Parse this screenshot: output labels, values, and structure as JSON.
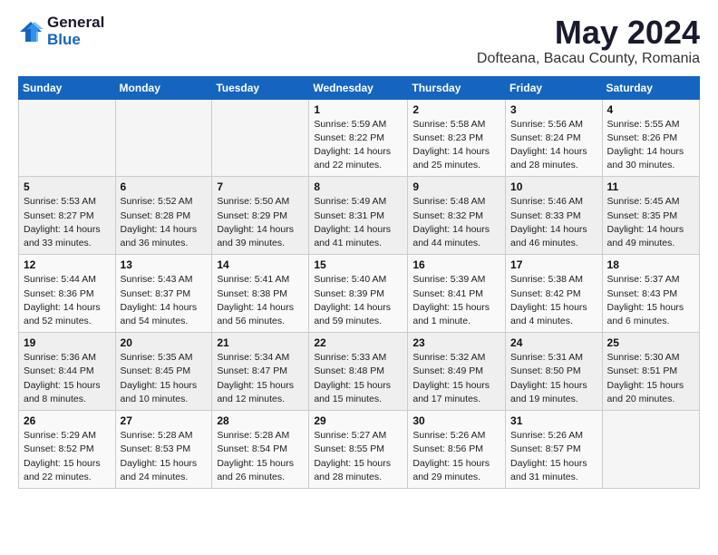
{
  "header": {
    "logo_general": "General",
    "logo_blue": "Blue",
    "title": "May 2024",
    "subtitle": "Dofteana, Bacau County, Romania"
  },
  "days_of_week": [
    "Sunday",
    "Monday",
    "Tuesday",
    "Wednesday",
    "Thursday",
    "Friday",
    "Saturday"
  ],
  "weeks": [
    [
      {
        "num": "",
        "info": ""
      },
      {
        "num": "",
        "info": ""
      },
      {
        "num": "",
        "info": ""
      },
      {
        "num": "1",
        "info": "Sunrise: 5:59 AM\nSunset: 8:22 PM\nDaylight: 14 hours\nand 22 minutes."
      },
      {
        "num": "2",
        "info": "Sunrise: 5:58 AM\nSunset: 8:23 PM\nDaylight: 14 hours\nand 25 minutes."
      },
      {
        "num": "3",
        "info": "Sunrise: 5:56 AM\nSunset: 8:24 PM\nDaylight: 14 hours\nand 28 minutes."
      },
      {
        "num": "4",
        "info": "Sunrise: 5:55 AM\nSunset: 8:26 PM\nDaylight: 14 hours\nand 30 minutes."
      }
    ],
    [
      {
        "num": "5",
        "info": "Sunrise: 5:53 AM\nSunset: 8:27 PM\nDaylight: 14 hours\nand 33 minutes."
      },
      {
        "num": "6",
        "info": "Sunrise: 5:52 AM\nSunset: 8:28 PM\nDaylight: 14 hours\nand 36 minutes."
      },
      {
        "num": "7",
        "info": "Sunrise: 5:50 AM\nSunset: 8:29 PM\nDaylight: 14 hours\nand 39 minutes."
      },
      {
        "num": "8",
        "info": "Sunrise: 5:49 AM\nSunset: 8:31 PM\nDaylight: 14 hours\nand 41 minutes."
      },
      {
        "num": "9",
        "info": "Sunrise: 5:48 AM\nSunset: 8:32 PM\nDaylight: 14 hours\nand 44 minutes."
      },
      {
        "num": "10",
        "info": "Sunrise: 5:46 AM\nSunset: 8:33 PM\nDaylight: 14 hours\nand 46 minutes."
      },
      {
        "num": "11",
        "info": "Sunrise: 5:45 AM\nSunset: 8:35 PM\nDaylight: 14 hours\nand 49 minutes."
      }
    ],
    [
      {
        "num": "12",
        "info": "Sunrise: 5:44 AM\nSunset: 8:36 PM\nDaylight: 14 hours\nand 52 minutes."
      },
      {
        "num": "13",
        "info": "Sunrise: 5:43 AM\nSunset: 8:37 PM\nDaylight: 14 hours\nand 54 minutes."
      },
      {
        "num": "14",
        "info": "Sunrise: 5:41 AM\nSunset: 8:38 PM\nDaylight: 14 hours\nand 56 minutes."
      },
      {
        "num": "15",
        "info": "Sunrise: 5:40 AM\nSunset: 8:39 PM\nDaylight: 14 hours\nand 59 minutes."
      },
      {
        "num": "16",
        "info": "Sunrise: 5:39 AM\nSunset: 8:41 PM\nDaylight: 15 hours\nand 1 minute."
      },
      {
        "num": "17",
        "info": "Sunrise: 5:38 AM\nSunset: 8:42 PM\nDaylight: 15 hours\nand 4 minutes."
      },
      {
        "num": "18",
        "info": "Sunrise: 5:37 AM\nSunset: 8:43 PM\nDaylight: 15 hours\nand 6 minutes."
      }
    ],
    [
      {
        "num": "19",
        "info": "Sunrise: 5:36 AM\nSunset: 8:44 PM\nDaylight: 15 hours\nand 8 minutes."
      },
      {
        "num": "20",
        "info": "Sunrise: 5:35 AM\nSunset: 8:45 PM\nDaylight: 15 hours\nand 10 minutes."
      },
      {
        "num": "21",
        "info": "Sunrise: 5:34 AM\nSunset: 8:47 PM\nDaylight: 15 hours\nand 12 minutes."
      },
      {
        "num": "22",
        "info": "Sunrise: 5:33 AM\nSunset: 8:48 PM\nDaylight: 15 hours\nand 15 minutes."
      },
      {
        "num": "23",
        "info": "Sunrise: 5:32 AM\nSunset: 8:49 PM\nDaylight: 15 hours\nand 17 minutes."
      },
      {
        "num": "24",
        "info": "Sunrise: 5:31 AM\nSunset: 8:50 PM\nDaylight: 15 hours\nand 19 minutes."
      },
      {
        "num": "25",
        "info": "Sunrise: 5:30 AM\nSunset: 8:51 PM\nDaylight: 15 hours\nand 20 minutes."
      }
    ],
    [
      {
        "num": "26",
        "info": "Sunrise: 5:29 AM\nSunset: 8:52 PM\nDaylight: 15 hours\nand 22 minutes."
      },
      {
        "num": "27",
        "info": "Sunrise: 5:28 AM\nSunset: 8:53 PM\nDaylight: 15 hours\nand 24 minutes."
      },
      {
        "num": "28",
        "info": "Sunrise: 5:28 AM\nSunset: 8:54 PM\nDaylight: 15 hours\nand 26 minutes."
      },
      {
        "num": "29",
        "info": "Sunrise: 5:27 AM\nSunset: 8:55 PM\nDaylight: 15 hours\nand 28 minutes."
      },
      {
        "num": "30",
        "info": "Sunrise: 5:26 AM\nSunset: 8:56 PM\nDaylight: 15 hours\nand 29 minutes."
      },
      {
        "num": "31",
        "info": "Sunrise: 5:26 AM\nSunset: 8:57 PM\nDaylight: 15 hours\nand 31 minutes."
      },
      {
        "num": "",
        "info": ""
      }
    ]
  ]
}
